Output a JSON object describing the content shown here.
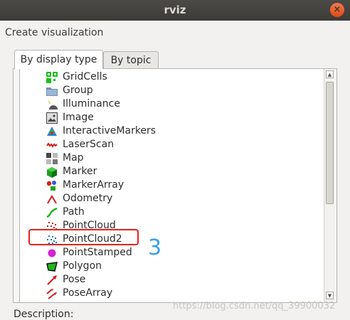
{
  "window": {
    "title": "rviz",
    "close_glyph": "×"
  },
  "dialog": {
    "heading": "Create visualization",
    "description_label": "Description:"
  },
  "tabs": [
    {
      "label": "By display type",
      "active": true
    },
    {
      "label": "By topic",
      "active": false
    }
  ],
  "list": {
    "items": [
      {
        "label": "GridCells",
        "icon": "grid-cells-icon"
      },
      {
        "label": "Group",
        "icon": "folder-icon"
      },
      {
        "label": "Illuminance",
        "icon": "illuminance-icon"
      },
      {
        "label": "Image",
        "icon": "image-icon"
      },
      {
        "label": "InteractiveMarkers",
        "icon": "interactive-markers-icon"
      },
      {
        "label": "LaserScan",
        "icon": "laser-scan-icon"
      },
      {
        "label": "Map",
        "icon": "map-icon"
      },
      {
        "label": "Marker",
        "icon": "marker-cube-icon"
      },
      {
        "label": "MarkerArray",
        "icon": "marker-array-icon"
      },
      {
        "label": "Odometry",
        "icon": "odometry-icon"
      },
      {
        "label": "Path",
        "icon": "path-icon"
      },
      {
        "label": "PointCloud",
        "icon": "point-cloud-icon"
      },
      {
        "label": "PointCloud2",
        "icon": "point-cloud2-icon"
      },
      {
        "label": "PointStamped",
        "icon": "point-stamped-icon"
      },
      {
        "label": "Polygon",
        "icon": "polygon-icon"
      },
      {
        "label": "Pose",
        "icon": "pose-icon"
      },
      {
        "label": "PoseArray",
        "icon": "pose-array-icon"
      }
    ]
  },
  "annotation": {
    "text": "3",
    "color": "#3aa0e6",
    "highlight_color": "#e8201a"
  },
  "watermark": "https://blog.csdn.net/qq_39900032",
  "colors": {
    "titlebar": "#3c3b37",
    "close_button": "#dd4814"
  }
}
